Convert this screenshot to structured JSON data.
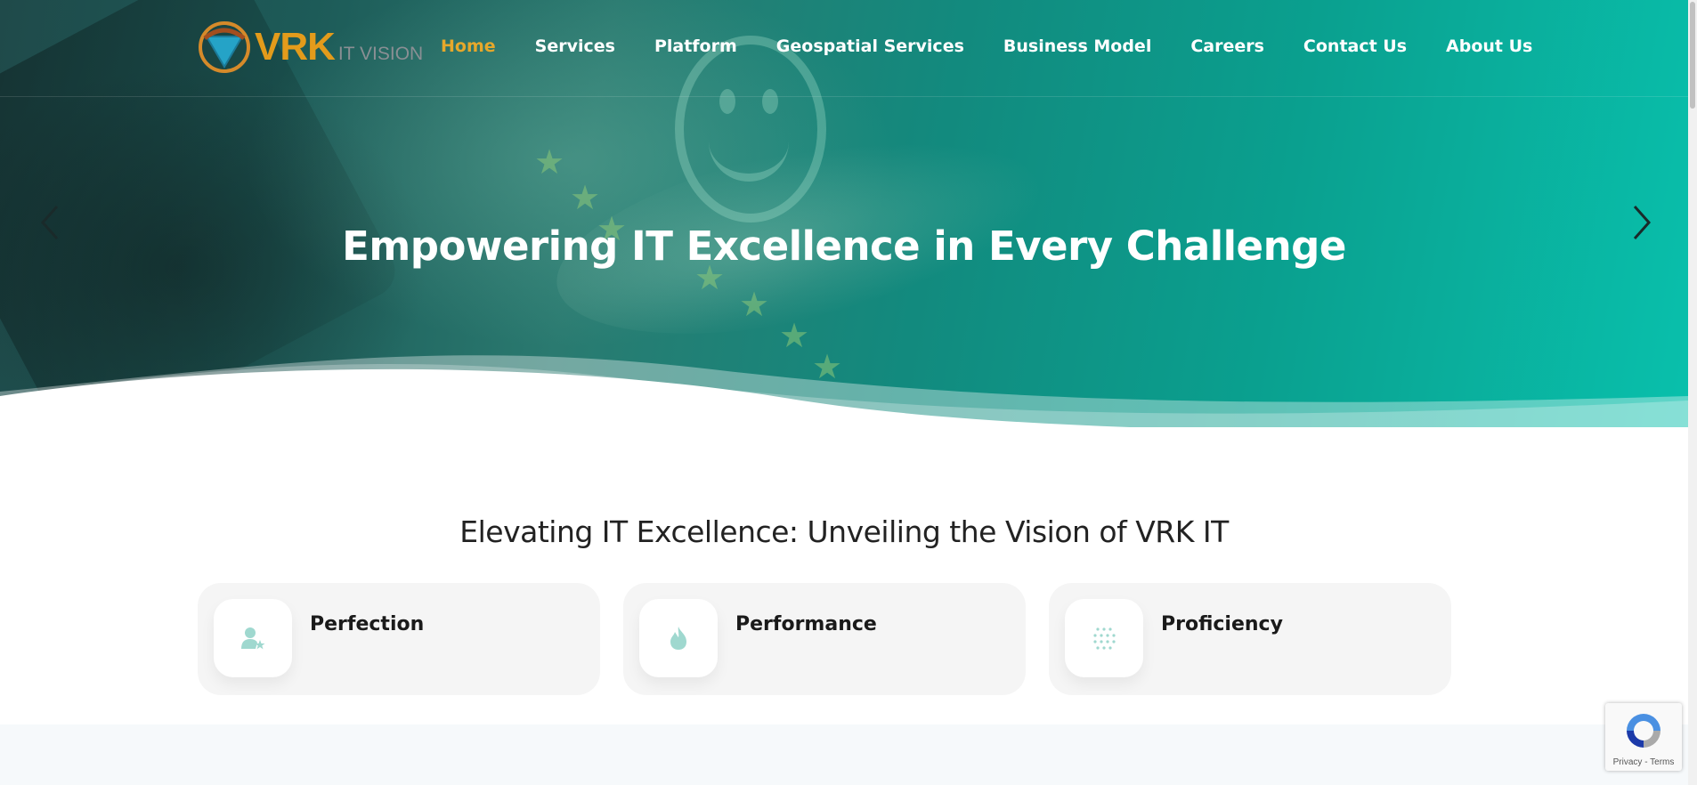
{
  "header": {
    "logo": {
      "brand": "VRK",
      "sub": "IT VISION"
    },
    "nav": [
      {
        "label": "Home",
        "active": true
      },
      {
        "label": "Services",
        "active": false
      },
      {
        "label": "Platform",
        "active": false
      },
      {
        "label": "Geospatial Services",
        "active": false
      },
      {
        "label": "Business Model",
        "active": false
      },
      {
        "label": "Careers",
        "active": false
      },
      {
        "label": "Contact Us",
        "active": false
      },
      {
        "label": "About Us",
        "active": false
      }
    ],
    "active_color": "#e6a82b"
  },
  "hero": {
    "title": "Empowering IT Excellence in Every Challenge",
    "prev_icon": "chevron-left-icon",
    "next_icon": "chevron-right-icon"
  },
  "section": {
    "title": "Elevating IT Excellence: Unveiling the Vision of VRK IT",
    "cards": [
      {
        "label": "Perfection",
        "icon": "user-star-icon"
      },
      {
        "label": "Performance",
        "icon": "flame-icon"
      },
      {
        "label": "Proficiency",
        "icon": "dots-grid-icon"
      }
    ]
  },
  "recaptcha": {
    "links": "Privacy - Terms"
  },
  "colors": {
    "accent": "#0aa08f",
    "nav_active": "#e6a82b",
    "icon_tint": "#9fd8cf"
  }
}
